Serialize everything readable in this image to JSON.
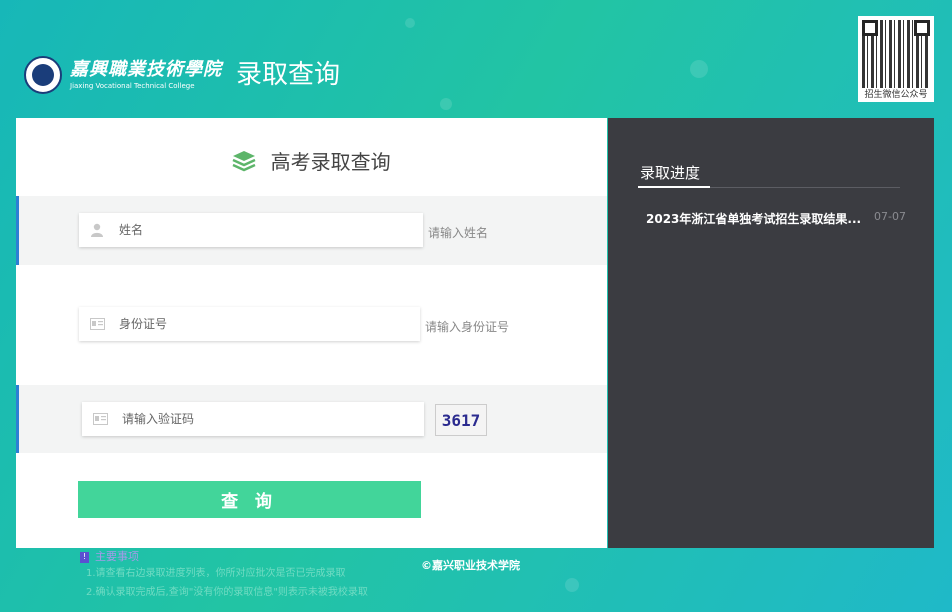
{
  "header": {
    "school_name_cn": "嘉興職業技術學院",
    "school_name_en": "Jiaxing Vocational Technical College",
    "page_title": "录取查询",
    "qr_caption": "招生微信公众号"
  },
  "form": {
    "title": "高考录取查询",
    "name_placeholder": "姓名",
    "name_hint": "请输入姓名",
    "id_placeholder": "身份证号",
    "id_hint": "请输入身份证号",
    "captcha_placeholder": "请输入验证码",
    "captcha_text": "3617",
    "submit_label": "查 询"
  },
  "progress": {
    "title": "录取进度",
    "items": [
      {
        "title": "2023年浙江省单独考试招生录取结果...",
        "date": "07-07"
      }
    ]
  },
  "footer": {
    "notice_title": "主要事项",
    "notice_lines": [
      "1.请查看右边录取进度列表，你所对应批次是否已完成录取",
      "2.确认录取完成后,查询\"没有你的录取信息\"则表示未被我校录取"
    ],
    "copyright": "©嘉兴职业技术学院"
  },
  "colors": {
    "background_start": "#17b7b8",
    "submit_button": "#42d59a",
    "right_panel": "#3b3c41",
    "accent_border": "#2d7fd4"
  },
  "icons": {
    "title_icon": "layers-icon",
    "name_icon": "user-icon",
    "id_icon": "id-card-icon",
    "captcha_icon": "id-card-icon"
  }
}
